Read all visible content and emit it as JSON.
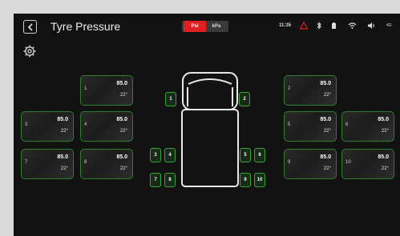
{
  "header": {
    "title": "Tyre Pressure",
    "units": {
      "selected": "Psi",
      "options": [
        "Psi",
        "kPa"
      ]
    },
    "status": {
      "time": "11:35",
      "network": "4G",
      "icons": [
        "warning-icon",
        "bluetooth-icon",
        "battery-icon",
        "wifi-icon",
        "volume-icon"
      ]
    }
  },
  "colors": {
    "accent_red": "#e02020",
    "tyre_ok_green": "#2faa2f"
  },
  "tyres": [
    {
      "id": "1",
      "pressure": "85.0",
      "temp": "22°"
    },
    {
      "id": "2",
      "pressure": "85.0",
      "temp": "22°"
    },
    {
      "id": "3",
      "pressure": "85.0",
      "temp": "22°"
    },
    {
      "id": "4",
      "pressure": "85.0",
      "temp": "22°"
    },
    {
      "id": "5",
      "pressure": "85.0",
      "temp": "22°"
    },
    {
      "id": "6",
      "pressure": "85.0",
      "temp": "22°"
    },
    {
      "id": "7",
      "pressure": "85.0",
      "temp": "22°"
    },
    {
      "id": "8",
      "pressure": "85.0",
      "temp": "22°"
    },
    {
      "id": "9",
      "pressure": "85.0",
      "temp": "22°"
    },
    {
      "id": "10",
      "pressure": "85.0",
      "temp": "22°"
    }
  ]
}
